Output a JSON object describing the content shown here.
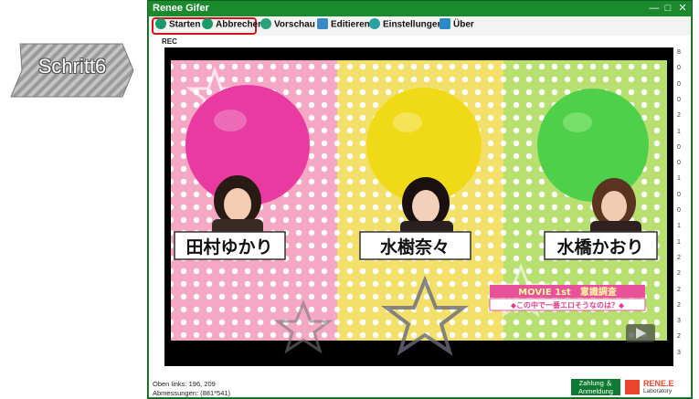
{
  "step_badge": {
    "label": "Schritt6"
  },
  "window": {
    "title": "Renee Gifer",
    "controls": {
      "minimize": "—",
      "maximize": "□",
      "close": "✕"
    }
  },
  "toolbar": {
    "items": [
      {
        "label": "Starten",
        "icon": "play-icon"
      },
      {
        "label": "Abbrechen",
        "icon": "stop-icon"
      },
      {
        "label": "Vorschau",
        "icon": "preview-icon"
      },
      {
        "label": "Editieren",
        "icon": "edit-icon"
      },
      {
        "label": "Einstellungen",
        "icon": "gear-icon"
      },
      {
        "label": "Über",
        "icon": "info-icon"
      }
    ],
    "highlighted": [
      "Starten",
      "Abbrechen"
    ]
  },
  "recording": {
    "label": "REC"
  },
  "video": {
    "name_plates": [
      "田村ゆかり",
      "水樹奈々",
      "水橋かおり"
    ],
    "caption_title": "MOVIE 1st　意識調査",
    "caption_sub": "◆この中で一番エロそうなのは？◆"
  },
  "side_digits": [
    "8",
    "0",
    "0",
    "0",
    "2",
    "1",
    "0",
    "0",
    "1",
    "0",
    "0",
    "1",
    "1",
    "2",
    "2",
    "2",
    "2",
    "3",
    "2",
    "3"
  ],
  "status": {
    "top_left": "Oben links: 196, 209",
    "size": "Abmessungen: (881*541)"
  },
  "pay_button": {
    "line1": "Zahlung ＆",
    "line2": "Anmeldung"
  },
  "logo": {
    "line1": "RENE.E",
    "line2": "Laboratory"
  },
  "colors": {
    "accent": "#1a8a2c",
    "highlight": "#d0161c",
    "brand": "#e8452c"
  }
}
